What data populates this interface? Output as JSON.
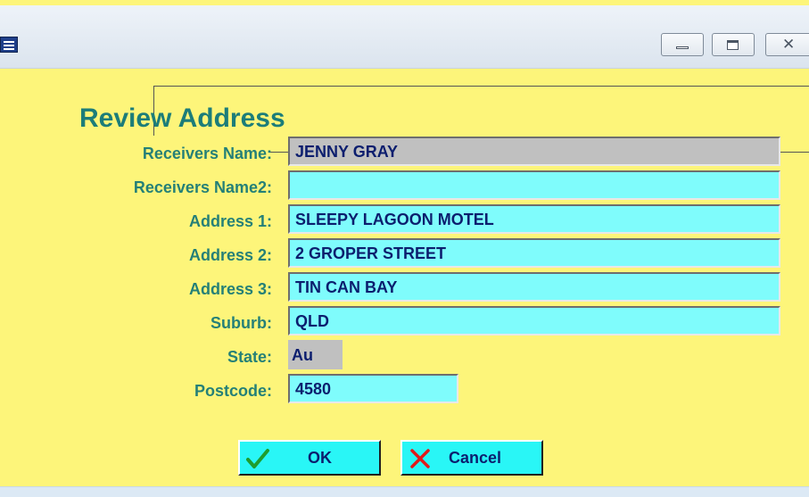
{
  "window": {
    "minimize_symbol": "–",
    "maximize_symbol": "□",
    "close_symbol": "✕"
  },
  "dialog": {
    "title": "Review Address",
    "fields": [
      {
        "label": "Receivers Name:",
        "value": "JENNY GRAY",
        "editable": false
      },
      {
        "label": "Receivers Name2:",
        "value": "",
        "editable": true
      },
      {
        "label": "Address 1:",
        "value": "SLEEPY LAGOON MOTEL",
        "editable": true
      },
      {
        "label": "Address 2:",
        "value": "2 GROPER STREET",
        "editable": true
      },
      {
        "label": "Address 3:",
        "value": "TIN CAN BAY",
        "editable": true
      },
      {
        "label": "Suburb:",
        "value": "QLD",
        "editable": true
      },
      {
        "label": "State:",
        "value": "Au",
        "editable": false
      },
      {
        "label": "Postcode:",
        "value": "4580",
        "editable": true
      }
    ],
    "buttons": {
      "ok_label": "OK",
      "ok_icon": "checkmark-icon",
      "cancel_label": "Cancel",
      "cancel_icon": "x-icon"
    }
  },
  "colors": {
    "background": "#fdf57a",
    "label_text": "#258077",
    "input_background": "#7ffcfc",
    "readonly_background": "#c0c0c0",
    "button_background": "#29f6f6",
    "value_text": "#0c1e6e"
  }
}
